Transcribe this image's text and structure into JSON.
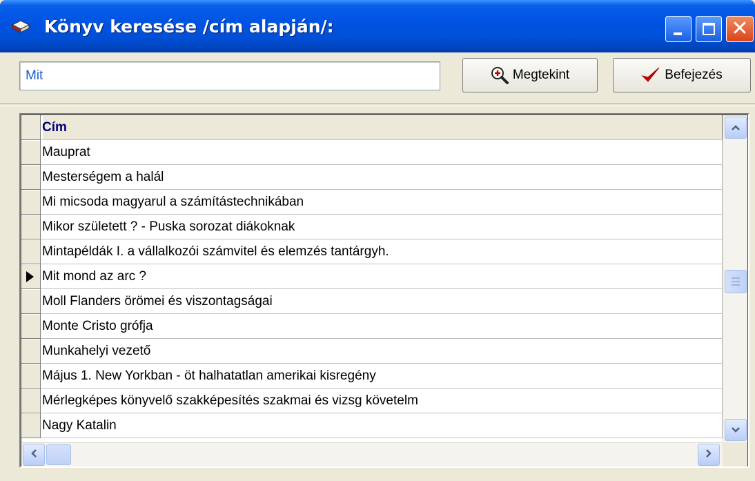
{
  "window": {
    "title": "Könyv keresése /cím alapján/:",
    "icon": "book-icon",
    "controls": {
      "minimize": "minimize-icon",
      "maximize": "maximize-icon",
      "close": "✕"
    }
  },
  "toolbar": {
    "search_value": "Mit",
    "view_label": "Megtekint",
    "view_icon": "magnifier-icon",
    "finish_label": "Befejezés",
    "finish_icon": "checkmark-icon"
  },
  "grid": {
    "column_header": "Cím",
    "current_row": 5,
    "rows": [
      "Mauprat",
      "Mesterségem a halál",
      "Mi micsoda magyarul a számítástechnikában",
      "Mikor született ? - Puska sorozat diákoknak",
      "Mintapéldák I. a vállalkozói számvitel és elemzés tantárgyh.",
      "Mit mond az arc ?",
      "Moll Flanders örömei és viszontagságai",
      "Monte Cristo grófja",
      "Munkahelyi vezető",
      "Május 1. New Yorkban - öt halhatatlan amerikai kisregény",
      "Mérlegképes könyvelő szakképesítés szakmai és vizsg követelm",
      "Nagy Katalin"
    ]
  },
  "colors": {
    "titlebar": "#0054e3",
    "close_button": "#d9431b",
    "header_text": "#00007f",
    "search_text": "#1a5fd0",
    "window_bg": "#ece9d8"
  }
}
